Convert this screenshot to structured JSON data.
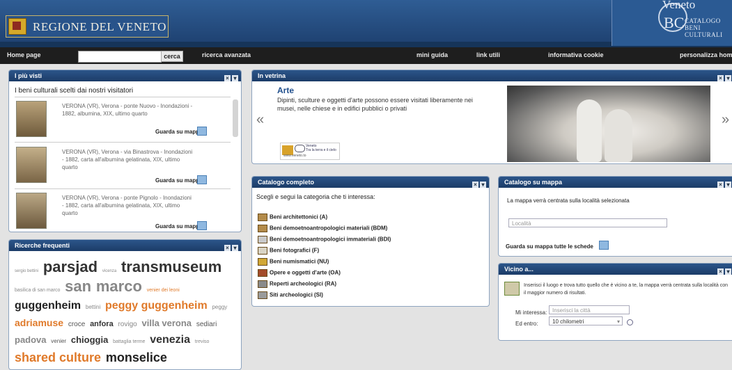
{
  "header": {
    "logo_text": "REGIONE DEL VENETO",
    "brand_name": "Veneto",
    "brand_sub": [
      "CATALOGO",
      "BENI",
      "CULTURALI"
    ]
  },
  "nav": {
    "home": "Home page",
    "search_placeholder": "",
    "search_button": "cerca",
    "advanced": "ricerca avanzata",
    "guide": "mini guida",
    "links": "link utili",
    "cookie": "informativa cookie",
    "custom": "personalizza home"
  },
  "most_viewed": {
    "title": "I più visti",
    "subtitle": "I beni culturali scelti dai nostri visitatori",
    "map_label": "Guarda su mappa",
    "items": [
      {
        "text": "VERONA (VR), Verona - ponte Nuovo - Inondazioni - 1882, albumina, XIX, ultimo quarto"
      },
      {
        "text": "VERONA (VR), Verona - via Binastrova - Inondazioni - 1882, carta all'albumina gelatinata, XIX, ultimo quarto"
      },
      {
        "text": "VERONA (VR), Verona - ponte Pignolo - Inondazioni - 1882, carta all'albumina gelatinata, XIX, ultimo quarto"
      }
    ]
  },
  "frequent": {
    "title": "Ricerche frequenti",
    "tags": [
      {
        "t": "sergio bettini",
        "s": 6,
        "c": "#888"
      },
      {
        "t": "parsjad",
        "s": 22,
        "c": "#333",
        "b": true
      },
      {
        "t": "vicenza",
        "s": 6,
        "c": "#888"
      },
      {
        "t": "transmuseum",
        "s": 22,
        "c": "#333",
        "b": true
      },
      {
        "t": "basilica di san marco",
        "s": 7,
        "c": "#888"
      },
      {
        "t": "san",
        "s": 22,
        "c": "#888",
        "b": true
      },
      {
        "t": "marco",
        "s": 22,
        "c": "#888",
        "b": true
      },
      {
        "t": "venier dei leoni",
        "s": 7,
        "c": "#e07a2a"
      },
      {
        "t": "guggenheim",
        "s": 16,
        "c": "#222",
        "b": true
      },
      {
        "t": "bettini",
        "s": 8,
        "c": "#888"
      },
      {
        "t": "peggy guggenheim",
        "s": 16,
        "c": "#e07a2a",
        "b": true
      },
      {
        "t": "peggy",
        "s": 8,
        "c": "#888"
      },
      {
        "t": "adriamuse",
        "s": 14,
        "c": "#e07a2a",
        "b": true
      },
      {
        "t": "croce",
        "s": 10,
        "c": "#555"
      },
      {
        "t": "anfora",
        "s": 11,
        "c": "#333",
        "b": true
      },
      {
        "t": "rovigo",
        "s": 10,
        "c": "#888"
      },
      {
        "t": "villa verona",
        "s": 13,
        "c": "#888",
        "b": true
      },
      {
        "t": "sediari",
        "s": 10,
        "c": "#555"
      },
      {
        "t": "padova",
        "s": 13,
        "c": "#888",
        "b": true
      },
      {
        "t": "venier",
        "s": 8,
        "c": "#555"
      },
      {
        "t": "chioggia",
        "s": 13,
        "c": "#333",
        "b": true
      },
      {
        "t": "battaglia terme",
        "s": 7,
        "c": "#888"
      },
      {
        "t": "venezia",
        "s": 16,
        "c": "#333",
        "b": true
      },
      {
        "t": "treviso",
        "s": 7,
        "c": "#888"
      },
      {
        "t": "shared culture",
        "s": 18,
        "c": "#e07a2a",
        "b": true
      },
      {
        "t": "monselice",
        "s": 18,
        "c": "#222",
        "b": true
      }
    ]
  },
  "showcase": {
    "title": "In vetrina",
    "heading": "Arte",
    "desc": "Dipinti, sculture e oggetti d'arte possono essere visitati liberamente nei musei, nelle chiese e in edifici pubblici o privati",
    "prev": "«",
    "next": "»",
    "badge_line1": "Veneto",
    "badge_line2": "Tra la terra e il cielo",
    "badge_url": "www.veneto.to"
  },
  "catalog": {
    "title": "Catalogo completo",
    "subtitle": "Scegli e segui la categoria che ti interessa:",
    "items": [
      "Beni architettonici (A)",
      "Beni demoetnoantropologici materiali (BDM)",
      "Beni demoetnoantropologici immateriali (BDI)",
      "Beni fotografici (F)",
      "Beni numismatici (NU)",
      "Opere e oggetti d'arte (OA)",
      "Reperti archeologici (RA)",
      "Siti archeologici (SI)"
    ]
  },
  "map": {
    "title": "Catalogo su mappa",
    "info": "La mappa verrà centrata sulla località selezionata",
    "placeholder": "Località",
    "all_link": "Guarda su mappa tutte le schede"
  },
  "near": {
    "title": "Vicino a...",
    "info": "Inserisci il luogo e trova tutto quello che è vicino a te, la mappa verrà centrata sulla località con il maggior numero di risultati.",
    "interest_label": "Mi interessa:",
    "city_placeholder": "Inserisci la città",
    "within_label": "Ed entro:",
    "distance": "10 chilometri"
  }
}
